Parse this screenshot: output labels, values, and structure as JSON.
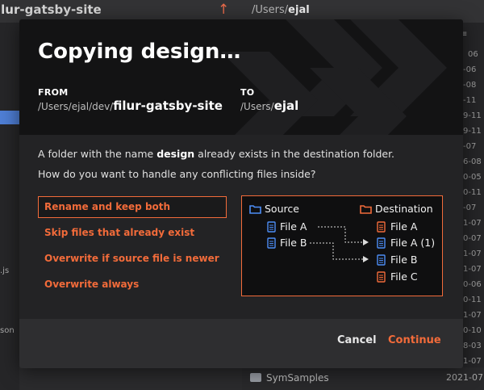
{
  "background": {
    "title": "ilur-gatsby-site",
    "path_prefix": "/Users/",
    "path_name": "ejal",
    "left_labels": [
      ".js",
      "son"
    ],
    "dates": [
      "06",
      "-06",
      "-08",
      "-11",
      "9-11",
      "9-11",
      "-07",
      "6-08",
      "0-05",
      "0-11",
      "-07",
      "1-07",
      "0-07",
      "1-07",
      "1-07",
      "0-06",
      "0-11",
      "1-07",
      "0-10",
      "8-03",
      "1-07"
    ],
    "bottom_row": {
      "name": "SymSamples",
      "date": "2021-07"
    }
  },
  "dialog": {
    "title": "Copying design…",
    "from_label": "FROM",
    "from_prefix": "/Users/ejal/dev/",
    "from_name": "filur-gatsby-site",
    "to_label": "TO",
    "to_prefix": "/Users/",
    "to_name": "ejal",
    "message_1_pre": "A folder with the name ",
    "message_1_bold": "design",
    "message_1_post": " already exists in the destination folder.",
    "message_2": "How do you want to handle any conflicting files inside?",
    "options": [
      {
        "label": "Rename and keep both",
        "selected": true
      },
      {
        "label": "Skip files that already exist",
        "selected": false
      },
      {
        "label": "Overwrite if source file is newer",
        "selected": false
      },
      {
        "label": "Overwrite always",
        "selected": false
      }
    ],
    "preview": {
      "source_label": "Source",
      "destination_label": "Destination",
      "source_files": [
        "File A",
        "File B"
      ],
      "destination_files": [
        "File A",
        "File A (1)",
        "File B",
        "File C"
      ]
    },
    "cancel_label": "Cancel",
    "continue_label": "Continue"
  },
  "colors": {
    "accent": "#f26b3a",
    "source_icon": "#4d8df5",
    "destination_icon": "#f26b3a",
    "selection": "#4f7fd6"
  }
}
